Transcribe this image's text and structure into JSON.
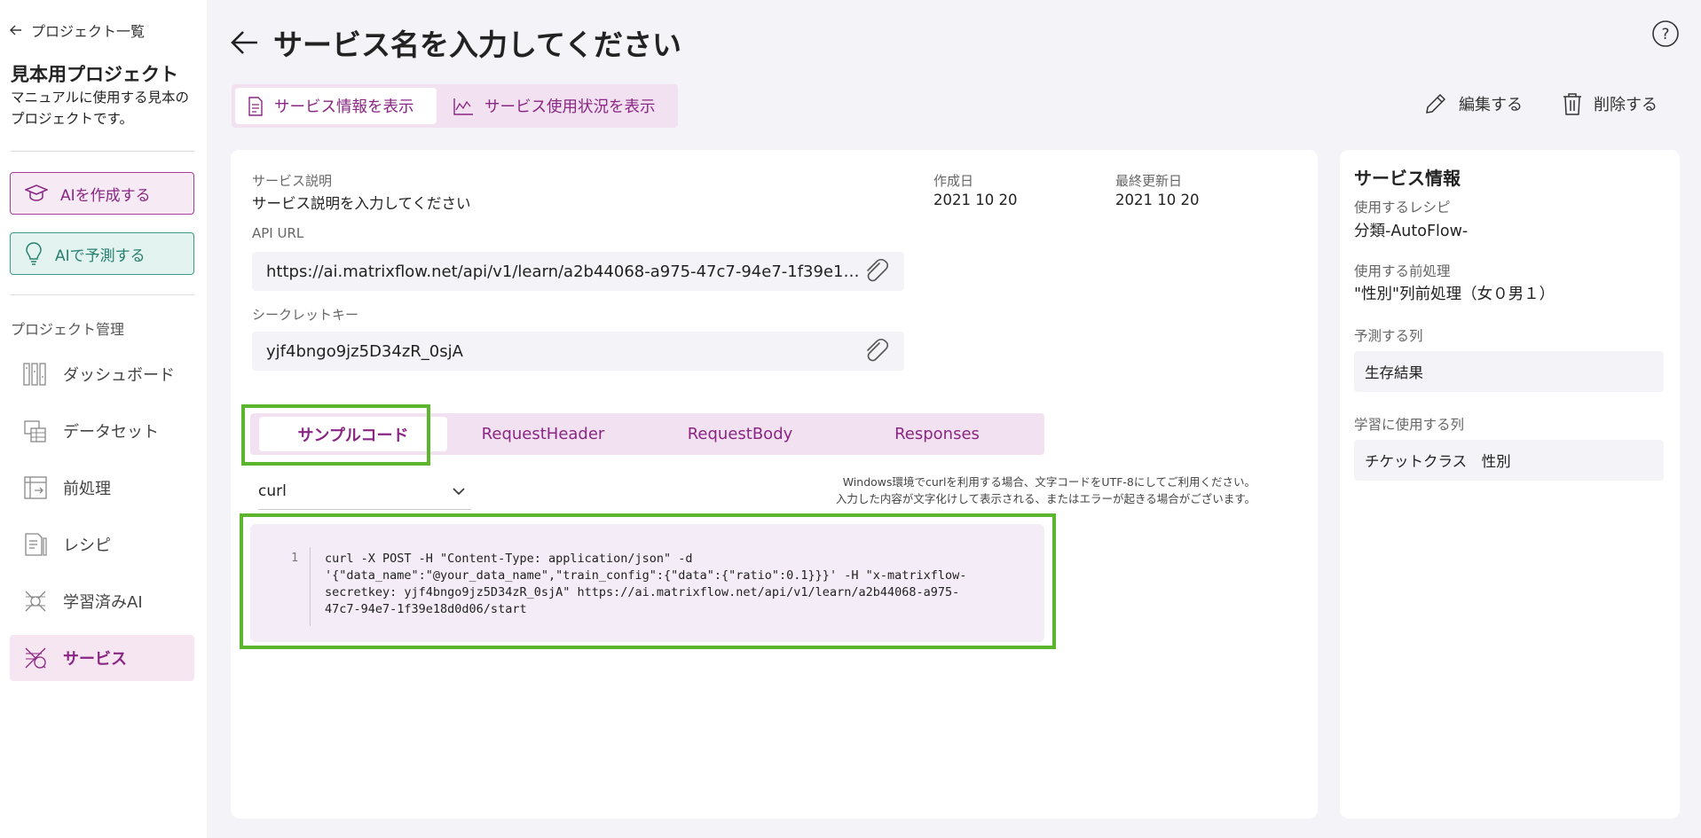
{
  "sidebar": {
    "back_label": "プロジェクト一覧",
    "project_name": "見本用プロジェクト",
    "project_description": "マニュアルに使用する見本のプロジェクトです。",
    "create_ai_label": "AIを作成する",
    "predict_ai_label": "AIで予測する",
    "section_label": "プロジェクト管理",
    "nav_items": [
      {
        "label": "ダッシュボード",
        "icon": "dashboard-icon"
      },
      {
        "label": "データセット",
        "icon": "dataset-icon"
      },
      {
        "label": "前処理",
        "icon": "preprocess-icon"
      },
      {
        "label": "レシピ",
        "icon": "recipe-icon"
      },
      {
        "label": "学習済みAI",
        "icon": "trained-ai-icon"
      },
      {
        "label": "サービス",
        "icon": "service-icon",
        "active": true
      }
    ]
  },
  "header": {
    "title": "サービス名を入力してください",
    "tabs": [
      {
        "label": "サービス情報を表示",
        "active": true
      },
      {
        "label": "サービス使用状況を表示",
        "active": false
      }
    ],
    "edit_label": "編集する",
    "delete_label": "削除する"
  },
  "main": {
    "description_label": "サービス説明",
    "description_value": "サービス説明を入力してください",
    "created_label": "作成日",
    "created_value": "2021 10 20",
    "updated_label": "最終更新日",
    "updated_value": "2021 10 20",
    "api_url_label": "API URL",
    "api_url_value": "https://ai.matrixflow.net/api/v1/learn/a2b44068-a975-47c7-94e7-1f39e18d...",
    "secret_label": "シークレットキー",
    "secret_value": "yjf4bngo9jz5D34zR_0sjA",
    "code_tabs": [
      "サンプルコード",
      "RequestHeader",
      "RequestBody",
      "Responses"
    ],
    "language": "curl",
    "windows_note_1": "Windows環境でcurlを利用する場合、文字コードをUTF-8にしてご利用ください。",
    "windows_note_2": "入力した内容が文字化けして表示される、またはエラーが起きる場合がございます。",
    "code_line_number": "1",
    "code": "curl -X POST -H \"Content-Type: application/json\" -d\n'{\"data_name\":\"@your_data_name\",\"train_config\":{\"data\":{\"ratio\":0.1}}}' -H \"x-matrixflow-\nsecretkey: yjf4bngo9jz5D34zR_0sjA\" https://ai.matrixflow.net/api/v1/learn/a2b44068-a975-\n47c7-94e7-1f39e18d0d06/start"
  },
  "info": {
    "title": "サービス情報",
    "recipe_label": "使用するレシピ",
    "recipe_value": "分類-AutoFlow-",
    "preprocess_label": "使用する前処理",
    "preprocess_value": "\"性別\"列前処理（女０男１）",
    "target_label": "予測する列",
    "target_value": "生存結果",
    "train_cols_label": "学習に使用する列",
    "train_cols_value": "チケットクラス　性別"
  },
  "colors": {
    "accent": "#8a2683",
    "teal": "#27806f",
    "highlight": "#5bb52d"
  }
}
